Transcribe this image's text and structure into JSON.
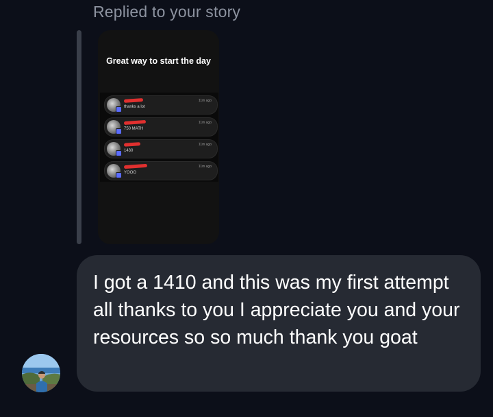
{
  "reply": {
    "label": "Replied to your story"
  },
  "story": {
    "title": "Great way to start the day",
    "rows": [
      {
        "text": "thanks a lot",
        "time": "11m ago"
      },
      {
        "text": "750 MATH",
        "time": "11m ago"
      },
      {
        "text": "1430",
        "time": "11m ago"
      },
      {
        "text": "YOOO",
        "time": "11m ago"
      }
    ]
  },
  "message": {
    "text": "I got a 1410 and this was my first attempt all thanks to you I appreciate you and your resources so so much thank you goat"
  },
  "colors": {
    "background": "#0c0f19",
    "bubble": "#262a33",
    "reply_label": "#8d93a0",
    "redaction": "#e0302f"
  }
}
